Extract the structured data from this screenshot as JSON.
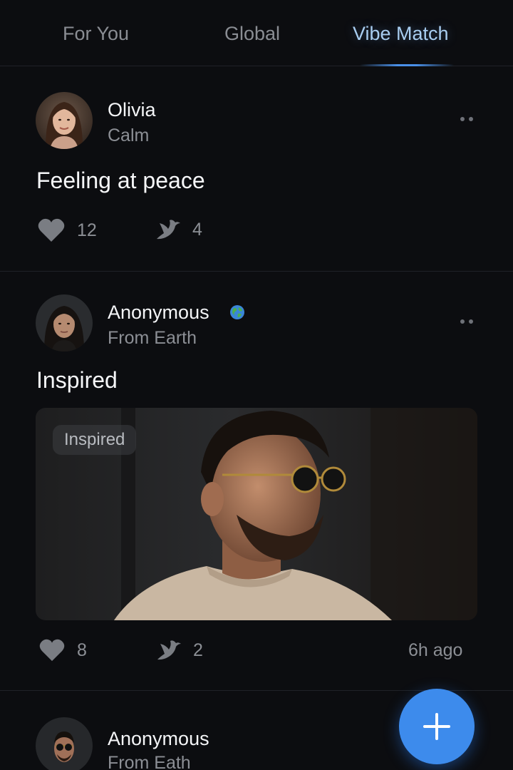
{
  "tabs": {
    "items": [
      {
        "label": "For You"
      },
      {
        "label": "Global"
      },
      {
        "label": "Vibe Match"
      }
    ],
    "active_index": 2,
    "accent_color": "#4a90e8"
  },
  "posts": [
    {
      "author": "Olivia",
      "subtitle": "Calm",
      "text": "Feeling at peace",
      "likes": "12",
      "echoes": "4",
      "has_image": false
    },
    {
      "author": "Anonymous",
      "author_badge_icon": "globe-icon",
      "subtitle": "From Earth",
      "text": "Inspired",
      "image_tag": "Inspired",
      "likes": "8",
      "echoes": "2",
      "time": "6h ago",
      "has_image": true
    },
    {
      "author": "Anonymous",
      "subtitle": "From Eath"
    }
  ],
  "fab": {
    "icon": "plus-icon",
    "color": "#3d8bec"
  }
}
